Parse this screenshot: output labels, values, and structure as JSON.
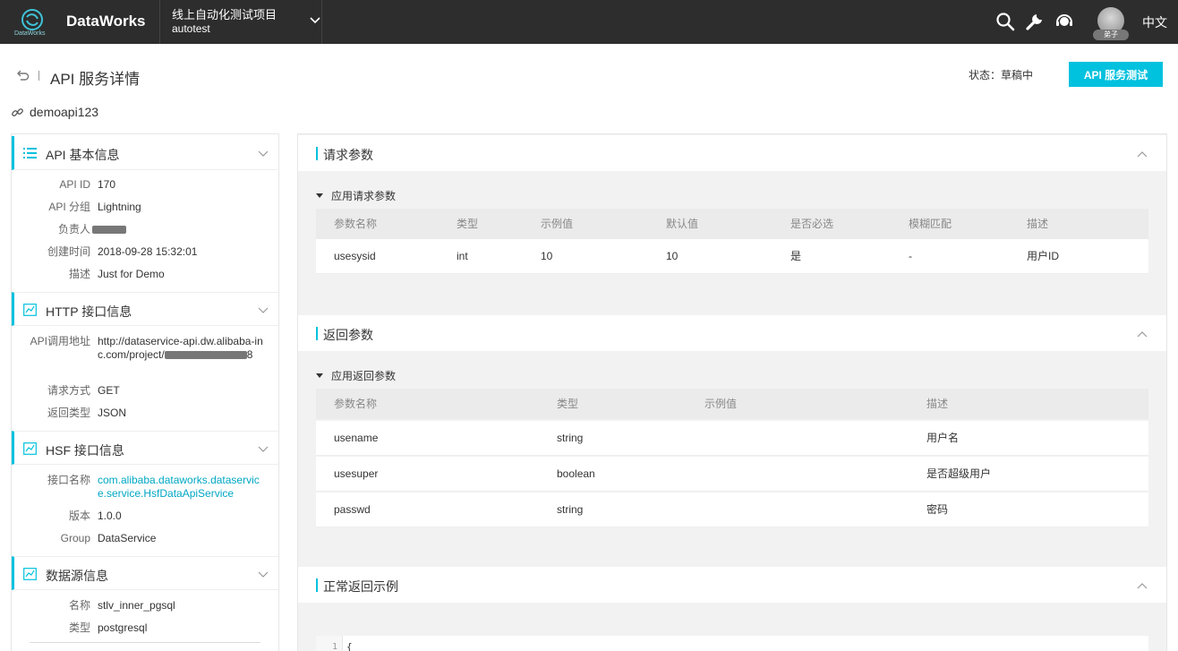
{
  "topbar": {
    "logo_caption": "DataWorks",
    "brand": "DataWorks",
    "project_name": "线上自动化测试项目",
    "project_id": "autotest",
    "avatar_tag": "弟子",
    "language": "中文",
    "icons": [
      "search-icon",
      "wrench-icon",
      "support-headset-icon",
      "chevron-down-icon"
    ]
  },
  "header": {
    "title": "API 服务详情",
    "status_label": "状态：草稿中",
    "test_button": "API 服务测试",
    "api_name": "demoapi123"
  },
  "colors": {
    "accent": "#00c1de",
    "topbar": "#2d2d2d",
    "link": "#00a7c4",
    "content_bg": "#f2f2f2"
  },
  "left": {
    "basic": {
      "title": "API 基本信息",
      "rows": [
        {
          "k": "API ID",
          "v": "170"
        },
        {
          "k": "API 分组",
          "v": "Lightning"
        },
        {
          "k": "负责人",
          "v": ""
        },
        {
          "k": "创建时间",
          "v": "2018-09-28 15:32:01"
        },
        {
          "k": "描述",
          "v": "Just for Demo"
        }
      ]
    },
    "http": {
      "title": "HTTP 接口信息",
      "url_key": "API调用地址",
      "url_prefix": "http://dataservice-api.dw.alibaba-inc.com/project/",
      "url_suffix": "8",
      "url_end": "8",
      "rows": [
        {
          "k": "请求方式",
          "v": "GET"
        },
        {
          "k": "返回类型",
          "v": "JSON"
        }
      ]
    },
    "hsf": {
      "title": "HSF 接口信息",
      "rows": [
        {
          "k": "接口名称",
          "v": "com.alibaba.dataworks.dataservice.service.HsfDataApiService"
        },
        {
          "k": "版本",
          "v": "1.0.0"
        },
        {
          "k": "Group",
          "v": "DataService"
        }
      ]
    },
    "datasource": {
      "title": "数据源信息",
      "rows": [
        {
          "k": "名称",
          "v": "stlv_inner_pgsql"
        },
        {
          "k": "类型",
          "v": "postgresql"
        }
      ]
    }
  },
  "request": {
    "title": "请求参数",
    "subtitle": "应用请求参数",
    "columns": [
      "参数名称",
      "类型",
      "示例值",
      "默认值",
      "是否必选",
      "模糊匹配",
      "描述"
    ],
    "rows": [
      [
        "usesysid",
        "int",
        "10",
        "10",
        "是",
        "-",
        "用户ID"
      ]
    ]
  },
  "response": {
    "title": "返回参数",
    "subtitle": "应用返回参数",
    "columns": [
      "参数名称",
      "类型",
      "示例值",
      "描述"
    ],
    "rows": [
      [
        "usename",
        "string",
        "",
        "用户名"
      ],
      [
        "usesuper",
        "boolean",
        "",
        "是否超级用户"
      ],
      [
        "passwd",
        "string",
        "",
        "密码"
      ]
    ]
  },
  "example": {
    "title": "正常返回示例",
    "line_no": "1",
    "code": "{"
  }
}
